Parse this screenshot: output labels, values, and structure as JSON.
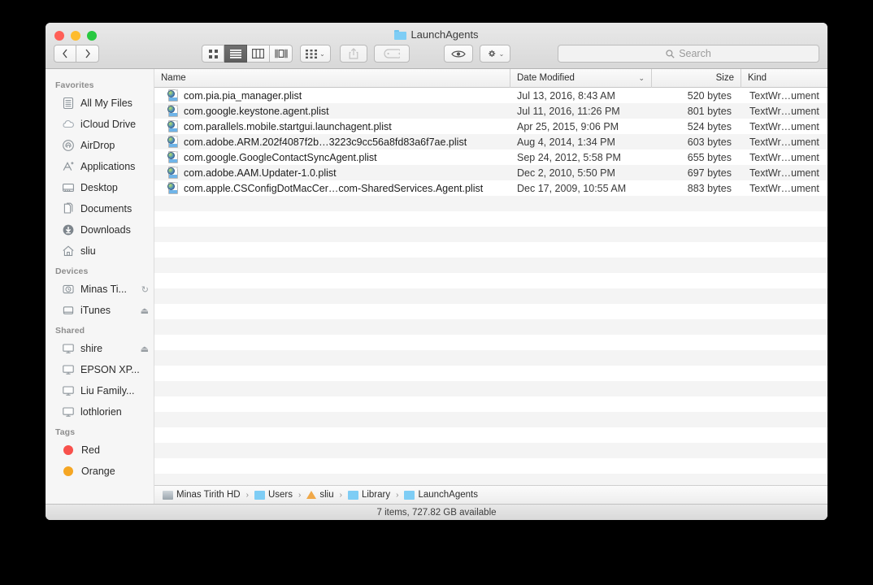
{
  "window": {
    "title": "LaunchAgents",
    "title_icon": "folder-icon"
  },
  "traffic_lights": {
    "close": "close-button",
    "minimize": "minimize-button",
    "maximize": "maximize-button"
  },
  "toolbar": {
    "back_label": "‹",
    "forward_label": "›",
    "view_icon_label": "icon-view",
    "view_list_label": "list-view",
    "view_column_label": "column-view",
    "view_coverflow_label": "coverflow-view",
    "arrange_label": "arrange-by",
    "share_label": "share",
    "tag_label": "edit-tags",
    "quicklook_label": "quick-look",
    "action_label": "action-menu",
    "chevron": "⌄"
  },
  "search": {
    "placeholder": "Search",
    "value": "",
    "icon": "search-icon"
  },
  "sidebar": {
    "sections": [
      {
        "header": "Favorites",
        "items": [
          {
            "label": "All My Files",
            "icon": "all-my-files-icon",
            "trailing": ""
          },
          {
            "label": "iCloud Drive",
            "icon": "icloud-icon",
            "trailing": ""
          },
          {
            "label": "AirDrop",
            "icon": "airdrop-icon",
            "trailing": ""
          },
          {
            "label": "Applications",
            "icon": "applications-icon",
            "trailing": ""
          },
          {
            "label": "Desktop",
            "icon": "desktop-icon",
            "trailing": ""
          },
          {
            "label": "Documents",
            "icon": "documents-icon",
            "trailing": ""
          },
          {
            "label": "Downloads",
            "icon": "downloads-icon",
            "trailing": ""
          },
          {
            "label": "sliu",
            "icon": "home-icon",
            "trailing": ""
          }
        ]
      },
      {
        "header": "Devices",
        "items": [
          {
            "label": "Minas Ti...",
            "icon": "time-machine-disk-icon",
            "trailing": "↻"
          },
          {
            "label": "iTunes",
            "icon": "external-disk-icon",
            "trailing": "⏏"
          }
        ]
      },
      {
        "header": "Shared",
        "items": [
          {
            "label": "shire",
            "icon": "display-icon",
            "trailing": "⏏"
          },
          {
            "label": "EPSON XP...",
            "icon": "display-icon",
            "trailing": ""
          },
          {
            "label": "Liu Family...",
            "icon": "display-icon",
            "trailing": ""
          },
          {
            "label": "lothlorien",
            "icon": "display-icon",
            "trailing": ""
          }
        ]
      },
      {
        "header": "Tags",
        "items": [
          {
            "label": "Red",
            "icon": "tag-dot-icon",
            "color": "#f8514c",
            "trailing": ""
          },
          {
            "label": "Orange",
            "icon": "tag-dot-icon",
            "color": "#f5a623",
            "trailing": ""
          }
        ]
      }
    ]
  },
  "file_list": {
    "columns": {
      "name": "Name",
      "date_modified": "Date Modified",
      "size": "Size",
      "kind": "Kind",
      "sort_chevron": "⌄"
    },
    "rows": [
      {
        "name": "com.pia.pia_manager.plist",
        "date": "Jul 13, 2016, 8:43 AM",
        "size": "520 bytes",
        "kind": "TextWr…ument",
        "icon": "plist-document-icon"
      },
      {
        "name": "com.google.keystone.agent.plist",
        "date": "Jul 11, 2016, 11:26 PM",
        "size": "801 bytes",
        "kind": "TextWr…ument",
        "icon": "plist-document-icon"
      },
      {
        "name": "com.parallels.mobile.startgui.launchagent.plist",
        "date": "Apr 25, 2015, 9:06 PM",
        "size": "524 bytes",
        "kind": "TextWr…ument",
        "icon": "plist-document-icon"
      },
      {
        "name": "com.adobe.ARM.202f4087f2b…3223c9cc56a8fd83a6f7ae.plist",
        "date": "Aug 4, 2014, 1:34 PM",
        "size": "603 bytes",
        "kind": "TextWr…ument",
        "icon": "plist-document-icon"
      },
      {
        "name": "com.google.GoogleContactSyncAgent.plist",
        "date": "Sep 24, 2012, 5:58 PM",
        "size": "655 bytes",
        "kind": "TextWr…ument",
        "icon": "plist-document-icon"
      },
      {
        "name": "com.adobe.AAM.Updater-1.0.plist",
        "date": "Dec 2, 2010, 5:50 PM",
        "size": "697 bytes",
        "kind": "TextWr…ument",
        "icon": "plist-document-icon"
      },
      {
        "name": "com.apple.CSConfigDotMacCer…com-SharedServices.Agent.plist",
        "date": "Dec 17, 2009, 10:55 AM",
        "size": "883 bytes",
        "kind": "TextWr…ument",
        "icon": "plist-document-icon"
      }
    ],
    "empty_row_count": 19
  },
  "pathbar": {
    "separator": "›",
    "segments": [
      {
        "label": "Minas Tirith HD",
        "icon": "hard-disk-icon"
      },
      {
        "label": "Users",
        "icon": "folder-icon"
      },
      {
        "label": "sliu",
        "icon": "home-folder-icon"
      },
      {
        "label": "Library",
        "icon": "folder-icon"
      },
      {
        "label": "LaunchAgents",
        "icon": "folder-icon"
      }
    ]
  },
  "statusbar": {
    "text": "7 items, 727.82 GB available"
  },
  "colors": {
    "row_stripe": "#f4f4f4",
    "sidebar_bg": "#f6f6f6",
    "accent_blue": "#7ecdf5"
  }
}
